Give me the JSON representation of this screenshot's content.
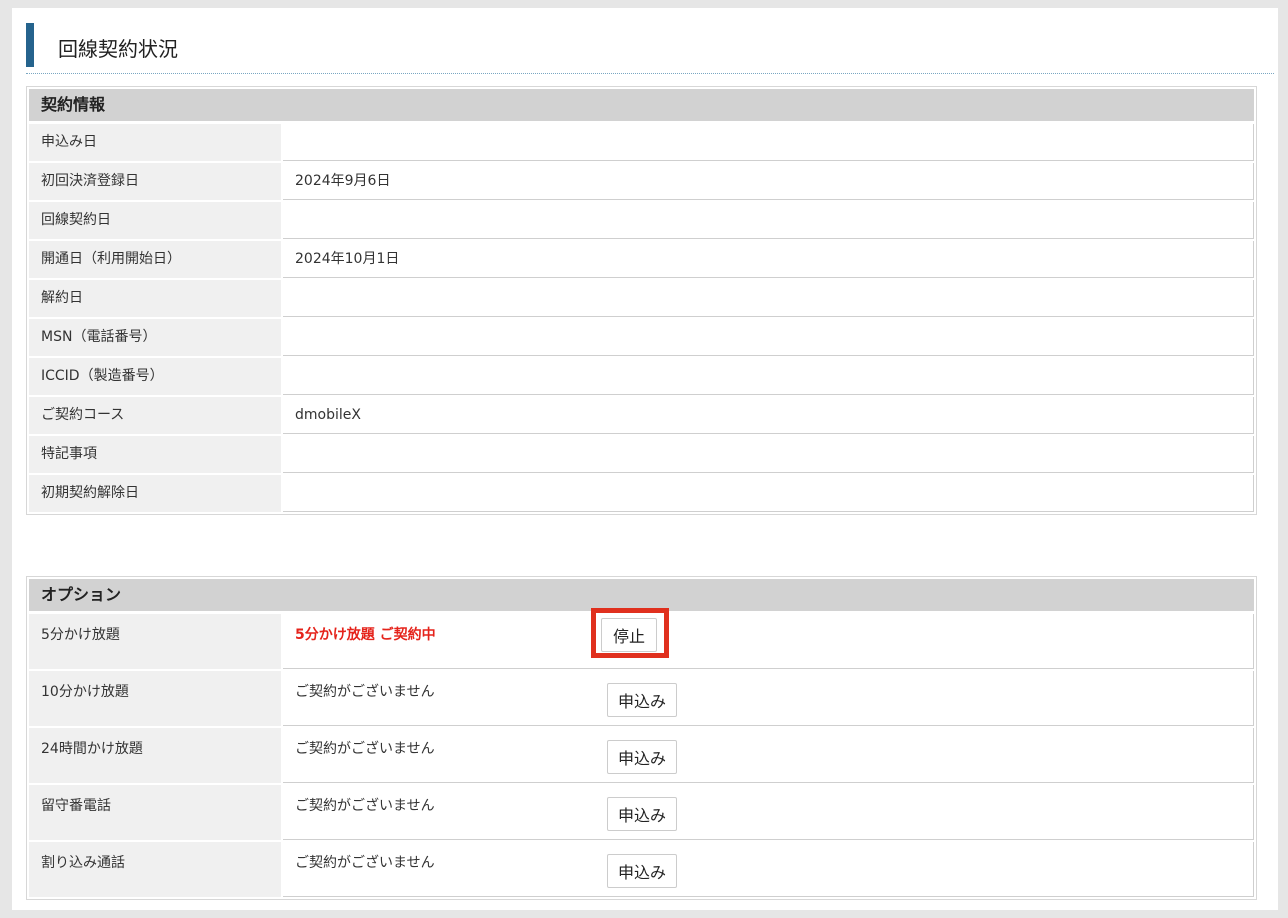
{
  "page_title": "回線契約状況",
  "contract": {
    "header": "契約情報",
    "rows": [
      {
        "label": "申込み日",
        "value": ""
      },
      {
        "label": "初回決済登録日",
        "value": "2024年9月6日"
      },
      {
        "label": "回線契約日",
        "value": ""
      },
      {
        "label": "開通日（利用開始日）",
        "value": "2024年10月1日"
      },
      {
        "label": "解約日",
        "value": ""
      },
      {
        "label": "MSN（電話番号）",
        "value": ""
      },
      {
        "label": "ICCID（製造番号）",
        "value": ""
      },
      {
        "label": "ご契約コース",
        "value": "dmobileX"
      },
      {
        "label": "特記事項",
        "value": ""
      },
      {
        "label": "初期契約解除日",
        "value": ""
      }
    ]
  },
  "options": {
    "header": "オプション",
    "rows": [
      {
        "label": "5分かけ放題",
        "status": "5分かけ放題 ご契約中",
        "button": "停止",
        "active": true
      },
      {
        "label": "10分かけ放題",
        "status": "ご契約がございません",
        "button": "申込み",
        "active": false
      },
      {
        "label": "24時間かけ放題",
        "status": "ご契約がございません",
        "button": "申込み",
        "active": false
      },
      {
        "label": "留守番電話",
        "status": "ご契約がございません",
        "button": "申込み",
        "active": false
      },
      {
        "label": "割り込み通話",
        "status": "ご契約がございません",
        "button": "申込み",
        "active": false
      }
    ]
  },
  "colors": {
    "accent": "#25638d",
    "active_status": "#e5231b",
    "highlight_box": "#e0301e"
  }
}
